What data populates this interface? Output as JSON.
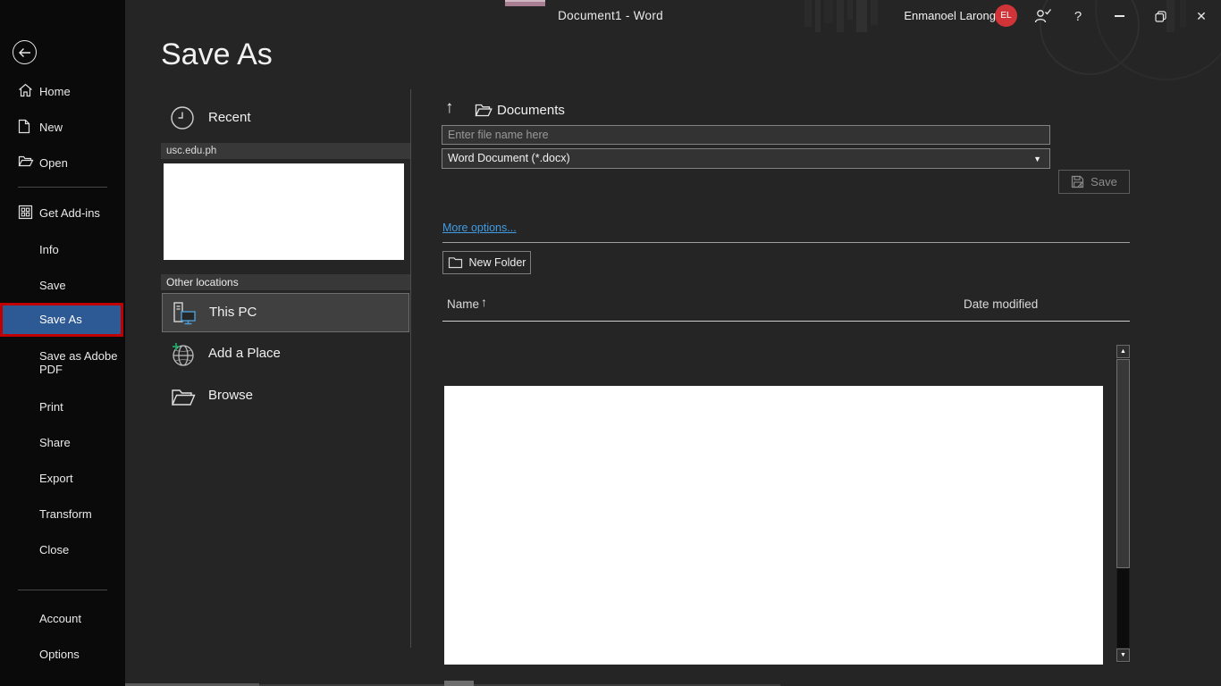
{
  "window": {
    "title": "Document1  -  Word"
  },
  "titlebar": {
    "user_name": "Enmanoel Larong",
    "avatar_initials": "EL",
    "help_icon": "?",
    "close_icon": "✕"
  },
  "sidebar": {
    "items": [
      "Home",
      "New",
      "Open",
      "Get Add-ins",
      "Info",
      "Save",
      "Save As",
      "Save as Adobe PDF",
      "Print",
      "Share",
      "Export",
      "Transform",
      "Close",
      "Account",
      "Options"
    ],
    "selected_item": "Save As"
  },
  "page": {
    "title": "Save As"
  },
  "places": {
    "recent_label": "Recent",
    "recent_item": "usc.edu.ph",
    "other_locations_label": "Other locations",
    "this_pc": "This PC",
    "add_a_place": "Add a Place",
    "browse": "Browse",
    "selected_location": "This PC"
  },
  "save_form": {
    "breadcrumb": "Documents",
    "filename_value": "",
    "filename_placeholder": "Enter file name here",
    "file_type": "Word Document (*.docx)",
    "save_button": "Save",
    "more_options_link": "More options...",
    "new_folder_button": "New Folder"
  },
  "file_list": {
    "name_header": "Name",
    "date_modified_header": "Date modified",
    "sort_icon": "↑"
  },
  "icons": {
    "caret": "▼",
    "scroll_up": "▲",
    "scroll_down": "▼",
    "breadcrumb_up": "↑"
  },
  "colors": {
    "selection_blue": "#2d5994",
    "annotation_red": "#c00000",
    "link_blue": "#429ce3",
    "avatar_red": "#d13438",
    "sidebar_black": "#0a0a0a",
    "backstage_gray": "#252525"
  }
}
